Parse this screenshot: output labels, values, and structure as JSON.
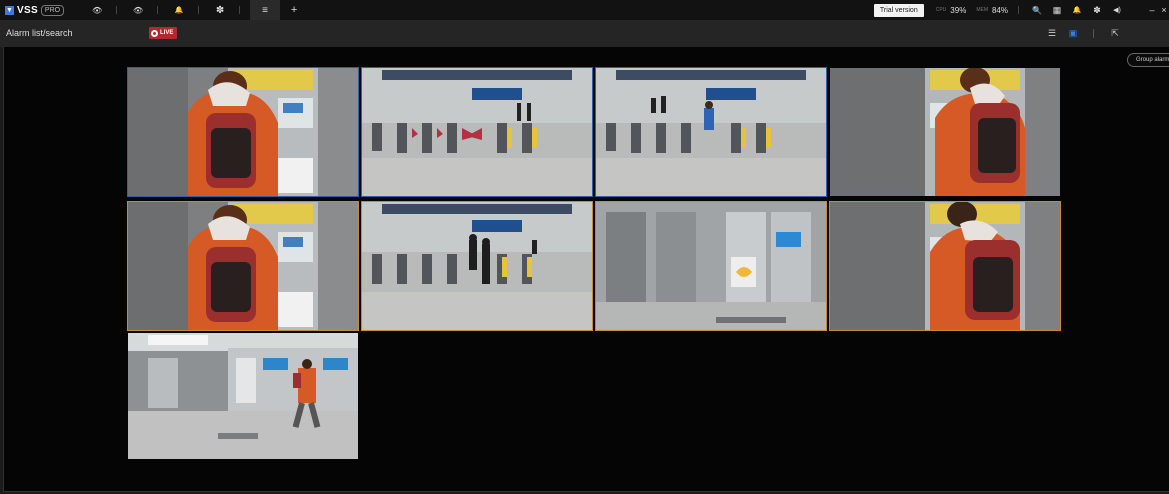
{
  "app": {
    "name": "VSS",
    "badge": "PRO"
  },
  "tabs": [
    {
      "icon": "eye-icon",
      "glyph": "👁"
    },
    {
      "icon": "eye-icon",
      "glyph": "👁"
    },
    {
      "icon": "bell-icon",
      "glyph": "🔔"
    },
    {
      "icon": "gear-icon",
      "glyph": "✽"
    },
    {
      "icon": "alarm-list-icon",
      "glyph": "≡"
    },
    {
      "icon": "plus-icon",
      "glyph": "+"
    }
  ],
  "status": {
    "trial_label": "Trial version",
    "cpu_label": "CPU",
    "cpu_value": "39%",
    "mem_label": "MEM",
    "mem_value": "84%"
  },
  "toolbar_icons": {
    "search": "🔍",
    "grid": "▦",
    "bell": "🔔",
    "settings": "✽",
    "volume": "◀)",
    "minimize": "–",
    "close": "×"
  },
  "page": {
    "title": "Alarm list/search",
    "live_label": "LIVE",
    "group_button": "Group alarm"
  },
  "view_icons": {
    "list": "☰",
    "thumbnail": "▣",
    "export": "⇱"
  },
  "accent": "#2c5fb0",
  "highlight": "#c9892c",
  "live_color": "#b8262e"
}
